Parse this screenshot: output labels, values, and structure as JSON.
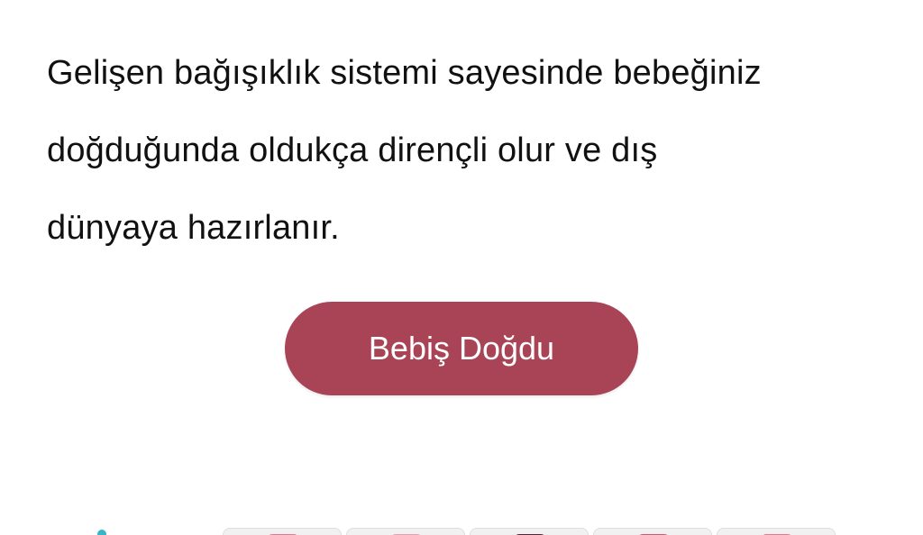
{
  "article": {
    "lines": [
      "Gelişen bağışıklık sistemi sayesinde bebeğiniz",
      "doğduğunda oldukça dirençli olur ve dış",
      "dünyaya hazırlanır."
    ]
  },
  "cta": {
    "label": "Bebiş Doğdu",
    "color": "#a94457"
  },
  "product_strip": {
    "items": [
      {
        "icon": "product-thumbnail",
        "accent": "#e07a93"
      },
      {
        "icon": "product-thumbnail",
        "accent": "#e8a1b3"
      },
      {
        "icon": "product-thumbnail",
        "accent": "#5a2337"
      },
      {
        "icon": "product-thumbnail",
        "accent": "#c95872"
      },
      {
        "icon": "product-thumbnail",
        "accent": "#e7788f"
      }
    ]
  }
}
